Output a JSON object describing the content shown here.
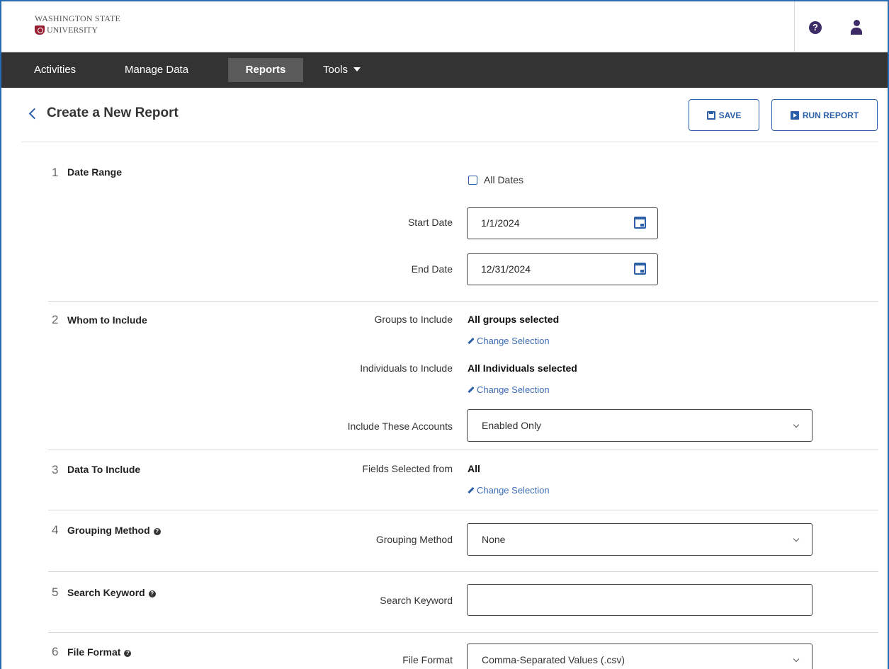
{
  "brand": {
    "line1": "WASHINGTON STATE",
    "line2": "UNIVERSITY"
  },
  "header_icons": [
    "help-icon",
    "user-icon"
  ],
  "nav": {
    "items": [
      {
        "label": "Activities"
      },
      {
        "label": "Manage Data"
      },
      {
        "label": "Reports",
        "active": true
      },
      {
        "label": "Tools"
      }
    ]
  },
  "page": {
    "title": "Create a New Report",
    "save_label": "SAVE",
    "run_label": "RUN REPORT"
  },
  "sections": {
    "s1": {
      "number": "1",
      "title": "Date Range",
      "all_dates_label": "All Dates",
      "all_dates_checked": false,
      "start_label": "Start Date",
      "start_value": "1/1/2024",
      "end_label": "End Date",
      "end_value": "12/31/2024"
    },
    "s2": {
      "number": "2",
      "title": "Whom to Include",
      "groups_label": "Groups to Include",
      "groups_value": "All groups selected",
      "individuals_label": "Individuals to Include",
      "individuals_value": "All Individuals selected",
      "change_label": "Change Selection",
      "accounts_label": "Include These Accounts",
      "accounts_value": "Enabled Only"
    },
    "s3": {
      "number": "3",
      "title": "Data To Include",
      "fields_label": "Fields Selected from",
      "fields_value": "All",
      "change_label": "Change Selection"
    },
    "s4": {
      "number": "4",
      "title": "Grouping Method",
      "label": "Grouping Method",
      "value": "None"
    },
    "s5": {
      "number": "5",
      "title": "Search Keyword",
      "label": "Search Keyword",
      "value": ""
    },
    "s6": {
      "number": "6",
      "title": "File Format",
      "label": "File Format",
      "value": "Comma-Separated Values (.csv)"
    }
  },
  "colors": {
    "nav_bg": "#333333",
    "nav_active": "#5a5a5a",
    "accent": "#2b5fa8",
    "brand_crimson": "#981e32",
    "icon_purple": "#3d2b66"
  }
}
